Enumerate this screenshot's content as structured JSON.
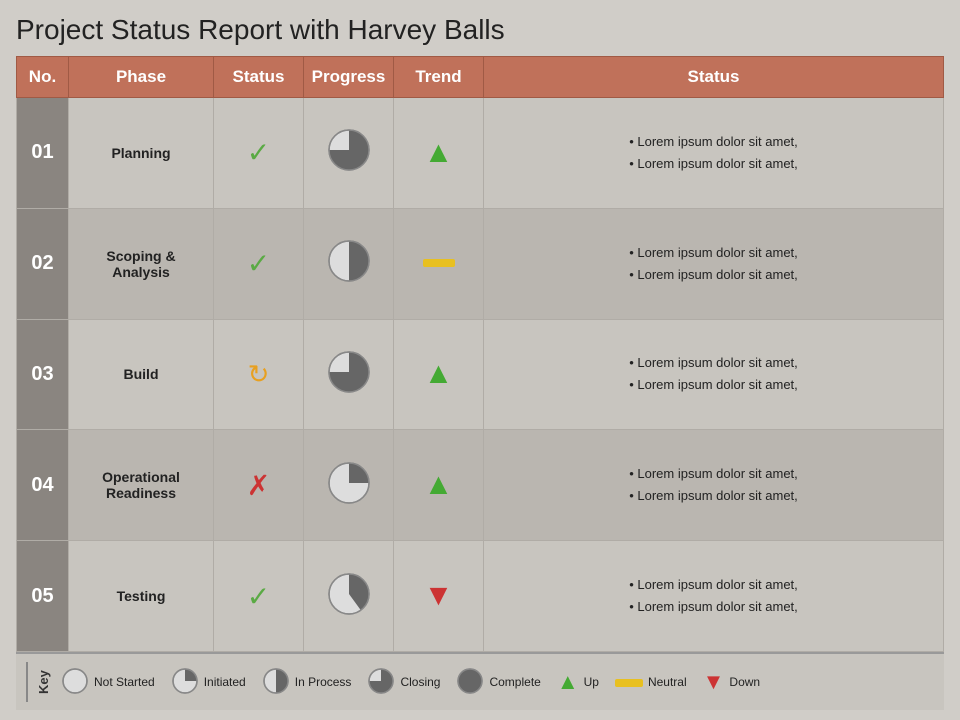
{
  "title": "Project Status Report with Harvey Balls",
  "header": {
    "cols": [
      "No.",
      "Phase",
      "Status",
      "Progress",
      "Trend",
      "Status"
    ]
  },
  "rows": [
    {
      "no": "01",
      "phase": "Planning",
      "status_type": "check",
      "progress": "75",
      "trend": "up",
      "desc": [
        "Lorem ipsum dolor sit amet,",
        "Lorem ipsum dolor sit amet,"
      ]
    },
    {
      "no": "02",
      "phase": "Scoping & Analysis",
      "status_type": "check",
      "progress": "50",
      "trend": "neutral",
      "desc": [
        "Lorem ipsum dolor sit amet,",
        "Lorem ipsum dolor sit amet,"
      ]
    },
    {
      "no": "03",
      "phase": "Build",
      "status_type": "cycle",
      "progress": "75",
      "trend": "up",
      "desc": [
        "Lorem ipsum dolor sit amet,",
        "Lorem ipsum dolor sit amet,"
      ]
    },
    {
      "no": "04",
      "phase": "Operational Readiness",
      "status_type": "cross",
      "progress": "25",
      "trend": "up",
      "desc": [
        "Lorem ipsum dolor sit amet,",
        "Lorem ipsum dolor sit amet,"
      ]
    },
    {
      "no": "05",
      "phase": "Testing",
      "status_type": "check",
      "progress": "40",
      "trend": "down",
      "desc": [
        "Lorem ipsum dolor sit amet,",
        "Lorem ipsum dolor sit amet,"
      ]
    }
  ],
  "legend": {
    "key_label": "Key",
    "items": [
      {
        "label": "Not Started",
        "type": "harvey0"
      },
      {
        "label": "Initiated",
        "type": "harvey25"
      },
      {
        "label": "In Process",
        "type": "harvey50"
      },
      {
        "label": "Closing",
        "type": "harvey75"
      },
      {
        "label": "Complete",
        "type": "harvey100"
      },
      {
        "label": "Up",
        "type": "arrow-up"
      },
      {
        "label": "Neutral",
        "type": "neutral"
      },
      {
        "label": "Down",
        "type": "arrow-down"
      }
    ]
  }
}
